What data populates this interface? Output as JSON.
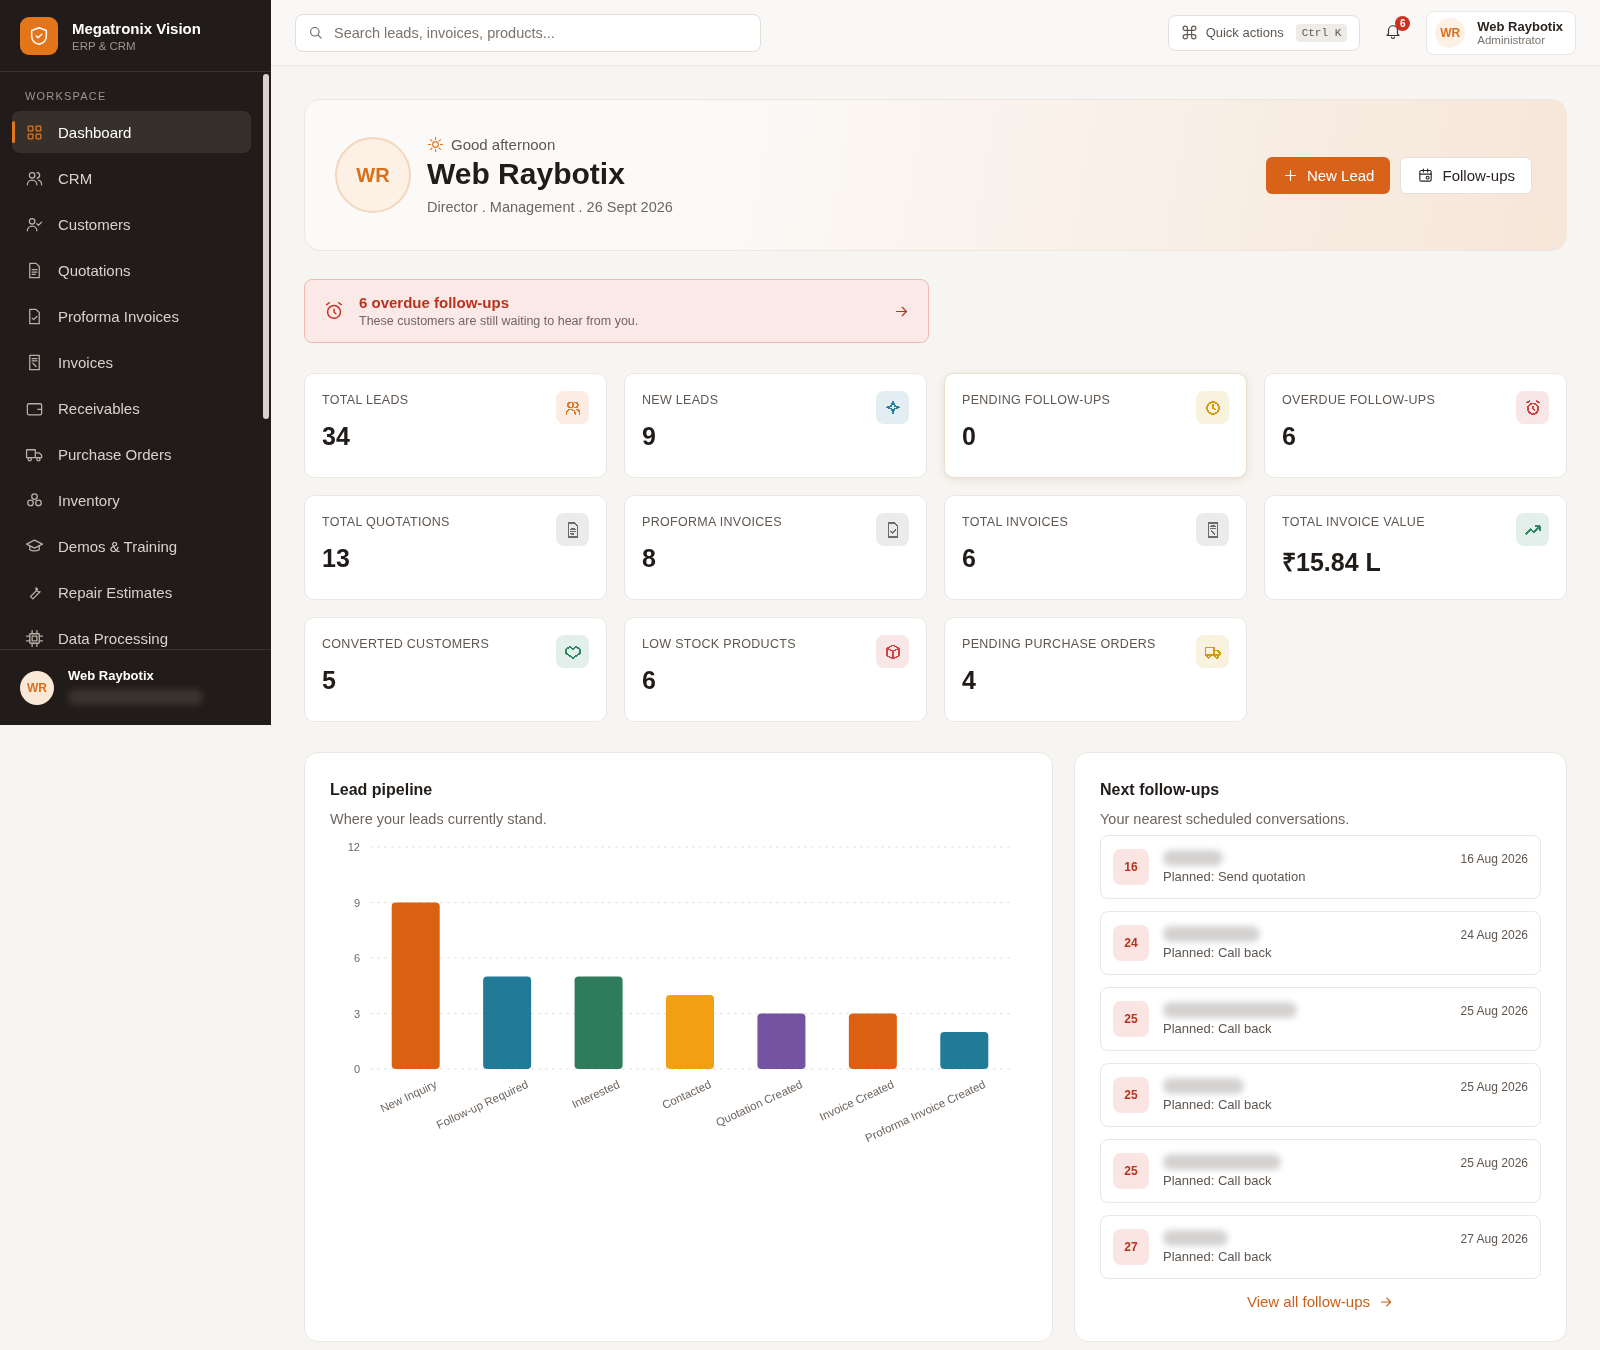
{
  "sidebar": {
    "brand": {
      "name": "Megatronix Vision",
      "subtitle": "ERP & CRM"
    },
    "section": "WORKSPACE",
    "items": [
      {
        "label": "Dashboard",
        "selected": true
      },
      {
        "label": "CRM",
        "selected": false
      },
      {
        "label": "Customers",
        "selected": false
      },
      {
        "label": "Quotations",
        "selected": false
      },
      {
        "label": "Proforma Invoices",
        "selected": false
      },
      {
        "label": "Invoices",
        "selected": false
      },
      {
        "label": "Receivables",
        "selected": false
      },
      {
        "label": "Purchase Orders",
        "selected": false
      },
      {
        "label": "Inventory",
        "selected": false
      },
      {
        "label": "Demos & Training",
        "selected": false
      },
      {
        "label": "Repair Estimates",
        "selected": false
      },
      {
        "label": "Data Processing",
        "selected": false
      }
    ],
    "user": {
      "initials": "WR",
      "name": "Web Raybotix",
      "email_redacted": true
    }
  },
  "topbar": {
    "search": {
      "placeholder": "Search leads, invoices, products..."
    },
    "quick_actions": {
      "label": "Quick actions",
      "shortcut": "Ctrl K"
    },
    "notifications": {
      "count": "6"
    },
    "user": {
      "initials": "WR",
      "name": "Web Raybotix",
      "role": "Administrator"
    }
  },
  "hero": {
    "initials": "WR",
    "greeting": "Good afternoon",
    "name": "Web Raybotix",
    "meta": "Director . Management . 26 Sept 2026",
    "buttons": [
      {
        "label": "New Lead",
        "kind": "primary"
      },
      {
        "label": "Follow-ups",
        "kind": "secondary"
      }
    ]
  },
  "alert": {
    "title": "6 overdue follow-ups",
    "text": "These customers are still waiting to hear from you."
  },
  "stats": [
    {
      "label": "TOTAL LEADS",
      "value": "34",
      "color": "#e07a2e"
    },
    {
      "label": "NEW LEADS",
      "value": "9",
      "color": "#2a7f9e"
    },
    {
      "label": "PENDING FOLLOW-UPS",
      "value": "0",
      "color": "#d49a10"
    },
    {
      "label": "OVERDUE FOLLOW-UPS",
      "value": "6",
      "color": "#d04444"
    },
    {
      "label": "TOTAL QUOTATIONS",
      "value": "13",
      "color": "#6b6b6b"
    },
    {
      "label": "PROFORMA INVOICES",
      "value": "8",
      "color": "#6b6b6b"
    },
    {
      "label": "TOTAL INVOICES",
      "value": "6",
      "color": "#6b6b6b"
    },
    {
      "label": "TOTAL INVOICE VALUE",
      "value": "₹15.84 L",
      "color": "#2e8a5e"
    },
    {
      "label": "CONVERTED CUSTOMERS",
      "value": "5",
      "color": "#2e8a5e"
    },
    {
      "label": "LOW STOCK PRODUCTS",
      "value": "6",
      "color": "#d04444"
    },
    {
      "label": "PENDING PURCHASE ORDERS",
      "value": "4",
      "color": "#d49a10"
    }
  ],
  "pipeline": {
    "title": "Lead pipeline",
    "subtitle": "Where your leads currently stand.",
    "chart_data": {
      "type": "bar",
      "categories": [
        "New Inquiry",
        "Follow-up Required",
        "Interested",
        "Contacted",
        "Quotation Created",
        "Invoice Created",
        "Proforma Invoice Created"
      ],
      "values": [
        9,
        5,
        5,
        4,
        3,
        3,
        2
      ],
      "colors": [
        "#dc6012",
        "#217a96",
        "#2f7c5c",
        "#f0a012",
        "#7353a2",
        "#dc6012",
        "#217a96"
      ],
      "ylim": [
        0,
        12
      ],
      "yticks": [
        0,
        3,
        6,
        9,
        12
      ],
      "grid": true
    }
  },
  "followups": {
    "title": "Next follow-ups",
    "subtitle": "Your nearest scheduled conversations.",
    "items": [
      {
        "day": "16",
        "name_redacted": true,
        "plan": "Planned: Send quotation",
        "date": "16 Aug 2026"
      },
      {
        "day": "24",
        "name_redacted": true,
        "plan": "Planned: Call back",
        "date": "24 Aug 2026"
      },
      {
        "day": "25",
        "name_redacted": true,
        "plan": "Planned: Call back",
        "date": "25 Aug 2026"
      },
      {
        "day": "25",
        "name_redacted": true,
        "plan": "Planned: Call back",
        "date": "25 Aug 2026"
      },
      {
        "day": "25",
        "name_redacted": true,
        "plan": "Planned: Call back",
        "date": "25 Aug 2026"
      },
      {
        "day": "27",
        "name_redacted": true,
        "plan": "Planned: Call back",
        "date": "27 Aug 2026"
      }
    ],
    "link": "View all follow-ups"
  }
}
